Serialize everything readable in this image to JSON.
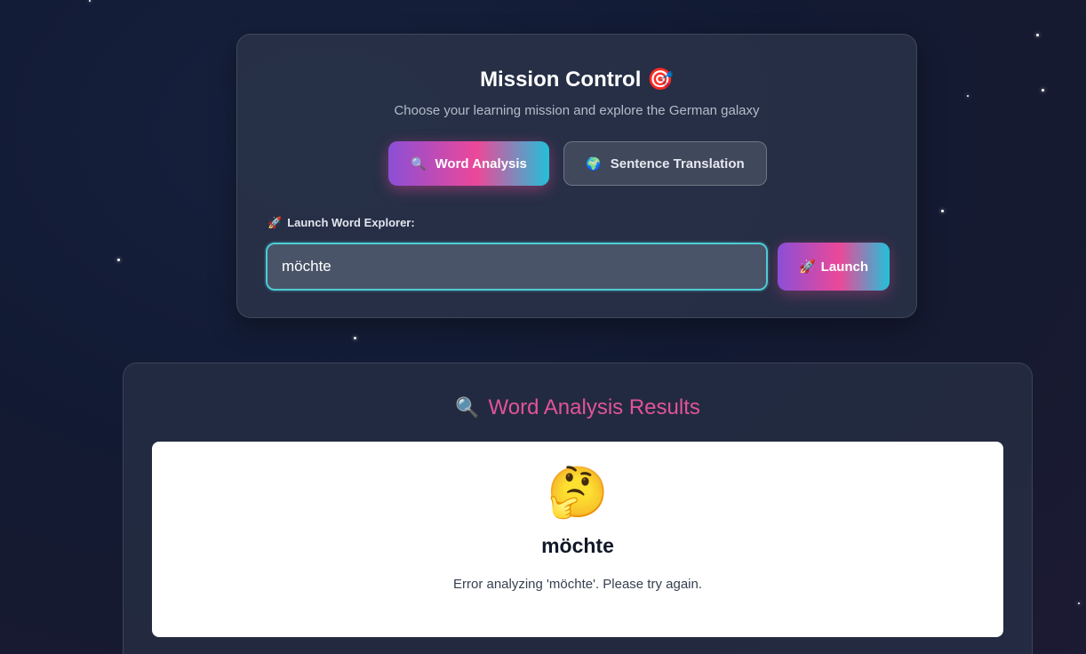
{
  "mission": {
    "title": "Mission Control 🎯",
    "subtitle": "Choose your learning mission and explore the German galaxy",
    "tabs": [
      {
        "icon": "🔍",
        "label": "Word Analysis",
        "active": true
      },
      {
        "icon": "🌍",
        "label": "Sentence Translation",
        "active": false
      }
    ],
    "input_label_icon": "🚀",
    "input_label": "Launch Word Explorer:",
    "input_value": "möchte",
    "launch_icon": "🚀",
    "launch_label": "Launch"
  },
  "results": {
    "title_icon": "🔍",
    "title": "Word Analysis Results",
    "emoji": "🤔",
    "word": "möchte",
    "message": "Error analyzing 'möchte'. Please try again."
  },
  "colors": {
    "accent_gradient_start": "#8b4fd6",
    "accent_gradient_mid": "#ec4899",
    "accent_gradient_end": "#22c1d8",
    "input_border": "#4ecdd6",
    "results_title": "#e2539a"
  }
}
